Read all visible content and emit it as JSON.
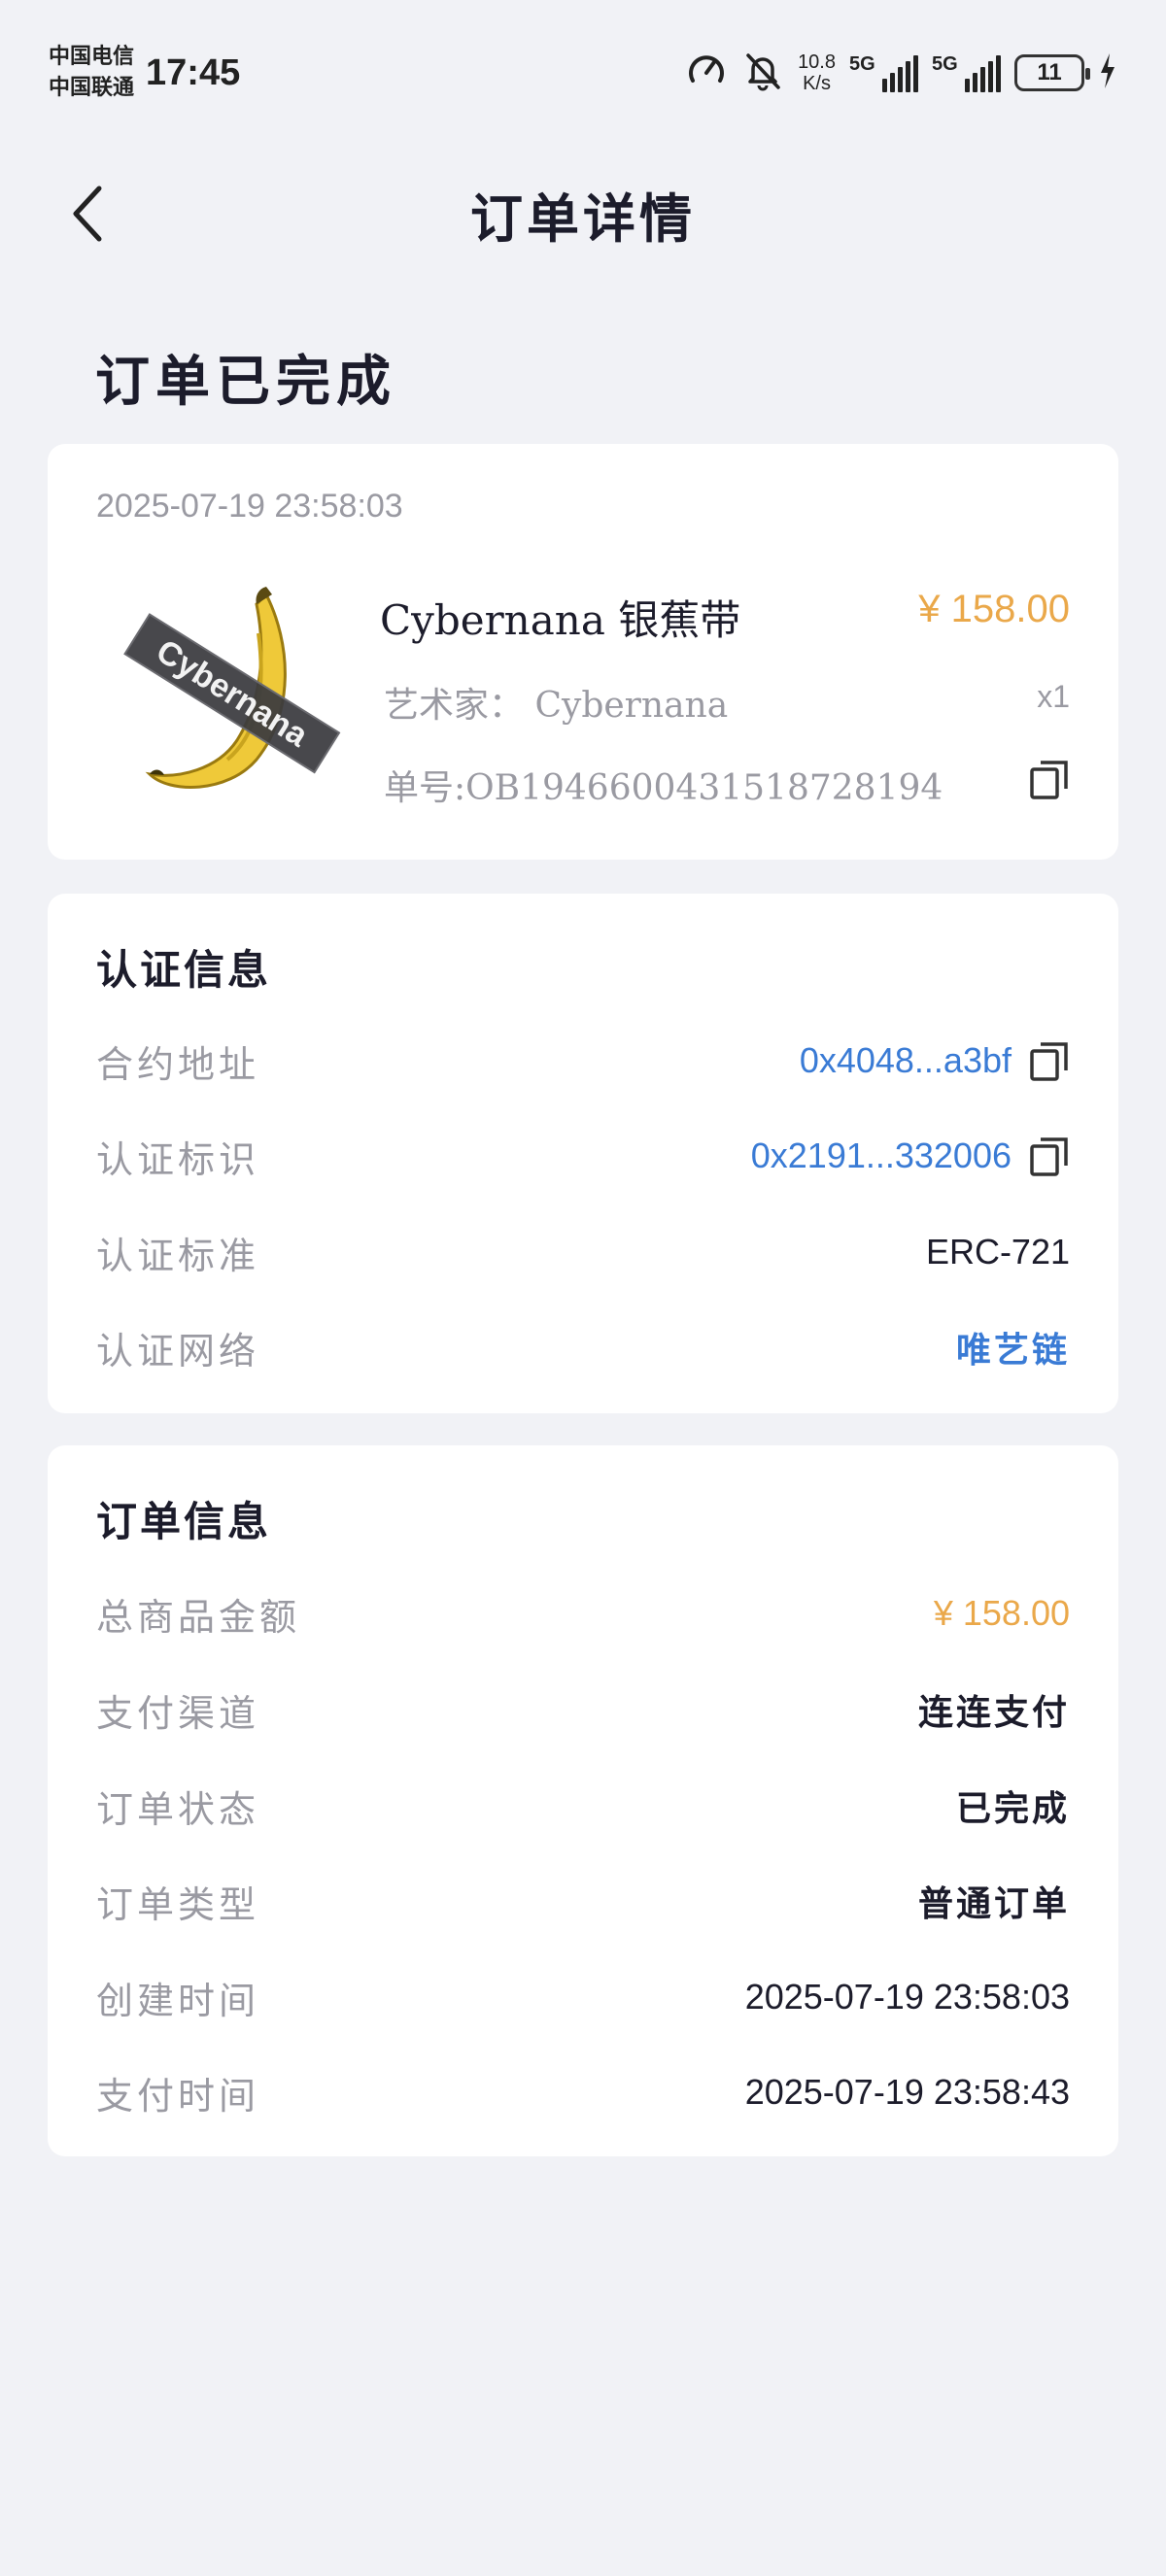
{
  "status_bar": {
    "carrier_1": "中国电信",
    "carrier_2": "中国联通",
    "time": "17:45",
    "net_speed_value": "10.8",
    "net_speed_unit": "K/s",
    "sim1_label": "5G",
    "sim2_label": "5G",
    "battery": "11"
  },
  "nav": {
    "title": "订单详情"
  },
  "order_status": "订单已完成",
  "product": {
    "order_time": "2025-07-19 23:58:03",
    "name": "Cybernana 银蕉带",
    "price": "¥ 158.00",
    "artist": "艺术家：  Cybernana",
    "quantity": "x1",
    "order_no": "单号:OB1946600431518728194",
    "image_tape_text": "Cybernana"
  },
  "certification": {
    "title": "认证信息",
    "rows": [
      {
        "label": "合约地址",
        "value": "0x4048...a3bf"
      },
      {
        "label": "认证标识",
        "value": "0x2191...332006"
      },
      {
        "label": "认证标准",
        "value": "ERC-721"
      },
      {
        "label": "认证网络",
        "value": "唯艺链"
      }
    ]
  },
  "order_info": {
    "title": "订单信息",
    "rows": [
      {
        "label": "总商品金额",
        "value": "¥ 158.00"
      },
      {
        "label": "支付渠道",
        "value": "连连支付"
      },
      {
        "label": "订单状态",
        "value": "已完成"
      },
      {
        "label": "订单类型",
        "value": "普通订单"
      },
      {
        "label": "创建时间",
        "value": "2025-07-19 23:58:03"
      },
      {
        "label": "支付时间",
        "value": "2025-07-19 23:58:43"
      }
    ]
  },
  "colors": {
    "background": "#f1f2f6",
    "card": "#ffffff",
    "accent_price": "#eaa84a",
    "link": "#3a7bd5",
    "muted_text": "#9a9aa2",
    "primary_text": "#1c1c2b"
  }
}
